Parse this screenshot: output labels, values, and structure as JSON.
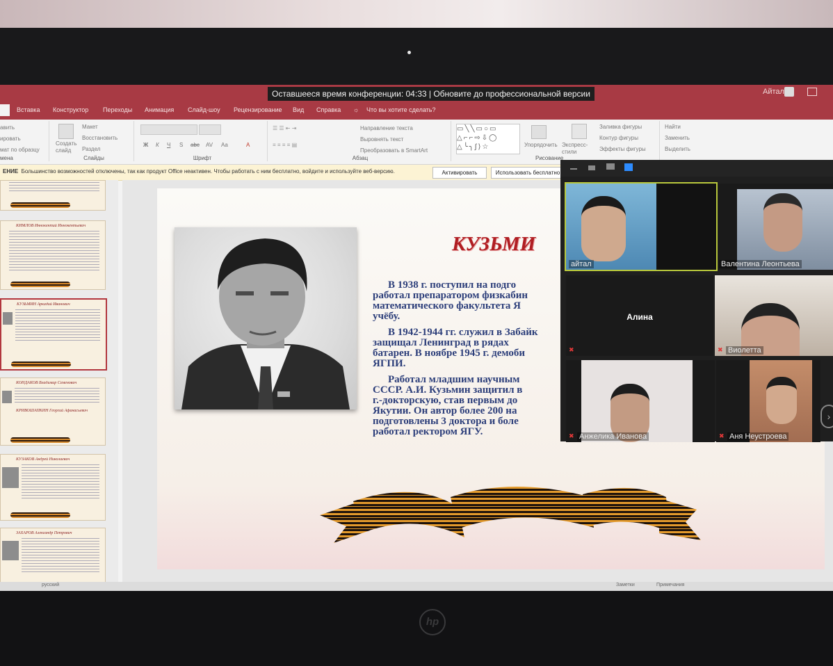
{
  "conference_banner": "Оставшееся время конференции: 04:33 | Обновите до профессиональной версии",
  "account": {
    "user_name": "Айтал"
  },
  "ribbon_tabs": [
    "Вставка",
    "Конструктор",
    "Переходы",
    "Анимация",
    "Слайд-шоу",
    "Рецензирование",
    "Вид",
    "Справка"
  ],
  "tell_me": "Что вы хотите сделать?",
  "ribbon": {
    "clipboard_items": [
      "авить",
      "ировать",
      "мат по образцу"
    ],
    "clipboard_group": "мена",
    "slides_items": [
      "Создать слайд",
      "Макет",
      "Восстановить",
      "Раздел"
    ],
    "slides_group": "Слайды",
    "font_group": "Шрифт",
    "font_buttons": [
      "Ж",
      "К",
      "Ч",
      "S",
      "abc",
      "AV",
      "Aa",
      "A"
    ],
    "paragraph_group": "Абзац",
    "paragraph_items": [
      "Направление текста",
      "Выровнять текст",
      "Преобразовать в SmartArt"
    ],
    "drawing_items": [
      "Упорядочить",
      "Экспресс-стили",
      "Заливка фигуры",
      "Контур фигуры",
      "Эффекты фигуры"
    ],
    "drawing_group": "Рисование",
    "editing_items": [
      "Найти",
      "Заменить",
      "Выделить"
    ]
  },
  "notice": {
    "label": "ЕНИЕ",
    "text": "Большинство возможностей отключены, так как продукт Office неактивен. Чтобы работать с ним бесплатно, войдите и используйте веб-версию.",
    "activate": "Активировать",
    "use_free": "Использовать бесплатно"
  },
  "thumbnails": [
    {
      "title": ""
    },
    {
      "title": "КИМЛОВ Иннокентий Иннокентьевич"
    },
    {
      "title": "КУЗЬМИН Аркадий Иванович"
    },
    {
      "title": "КОНДАКОВ Владимир Семенович"
    },
    {
      "title": "КРИВОШАПКИН Георгий Афанасьевич"
    },
    {
      "title": "КУЗАКОВ Андрей Николаевич"
    },
    {
      "title": "ЗАХАРОВ Александр Петрович"
    }
  ],
  "slide": {
    "title": "КУЗЬМИ",
    "paragraphs": [
      [
        "В 1938 г. поступил на подго",
        "работал препаратором физкабин",
        "математического факультета Я",
        "учёбу."
      ],
      [
        "В 1942-1944 гг. служил в Забайк",
        "защищал Ленинград в рядах",
        "батарен. В ноябре 1945 г. демоби",
        "ЯГПИ."
      ],
      [
        "Работал младшим научным",
        "СССР. А.И. Кузьмин защитил в",
        "г.-докторскую, став первым до",
        "Якутии. Он автор более 200 на",
        "подготовлены 3 доктора и боле",
        "работал ректором ЯГУ."
      ]
    ]
  },
  "status_bar": {
    "lang": "русский",
    "notes": "Заметки",
    "comments": "Примечания"
  },
  "zoom": {
    "participants": [
      {
        "name": "айтал",
        "speaking": true,
        "muted": false
      },
      {
        "name": "Валентина Леонтьева",
        "speaking": false,
        "muted": false
      },
      {
        "name": "Алина",
        "speaking": false,
        "muted": true,
        "video": false
      },
      {
        "name": "Виолетта",
        "speaking": false,
        "muted": true
      },
      {
        "name": "Анжелика Иванова",
        "speaking": false,
        "muted": true
      },
      {
        "name": "Аня Неустроева",
        "speaking": false,
        "muted": true
      }
    ]
  },
  "colors": {
    "accent": "#a83a44",
    "title_red": "#b01e23",
    "body_blue": "#2c3e7a",
    "speaker_outline": "#b9c83c"
  }
}
